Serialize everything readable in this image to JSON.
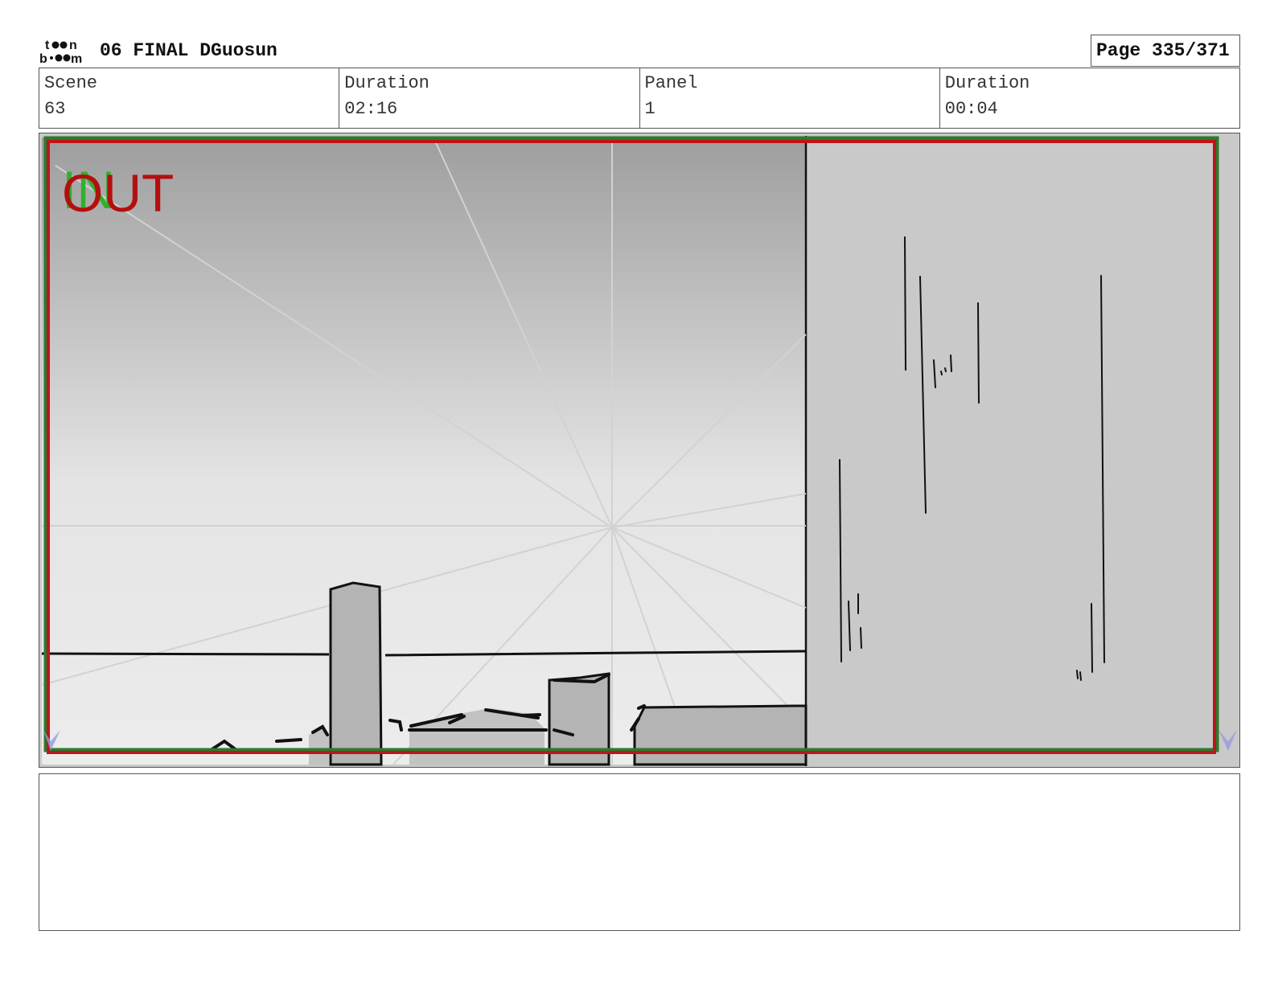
{
  "header": {
    "logo_text": "toon boom",
    "title": "06 FINAL DGuosun",
    "page_label": "Page 335/371"
  },
  "info": {
    "scene_label": "Scene",
    "scene_value": "63",
    "scene_duration_label": "Duration",
    "scene_duration_value": "02:16",
    "panel_label": "Panel",
    "panel_value": "1",
    "panel_duration_label": "Duration",
    "panel_duration_value": "00:04"
  },
  "panel": {
    "in_marker": "IN",
    "out_marker": "OUT",
    "colors": {
      "in_marker": "#2db22d",
      "out_marker": "#b30f0f",
      "camera_frame": "#c0141a",
      "safe_frame": "#2c7a2c"
    }
  },
  "notes": {
    "text": ""
  }
}
